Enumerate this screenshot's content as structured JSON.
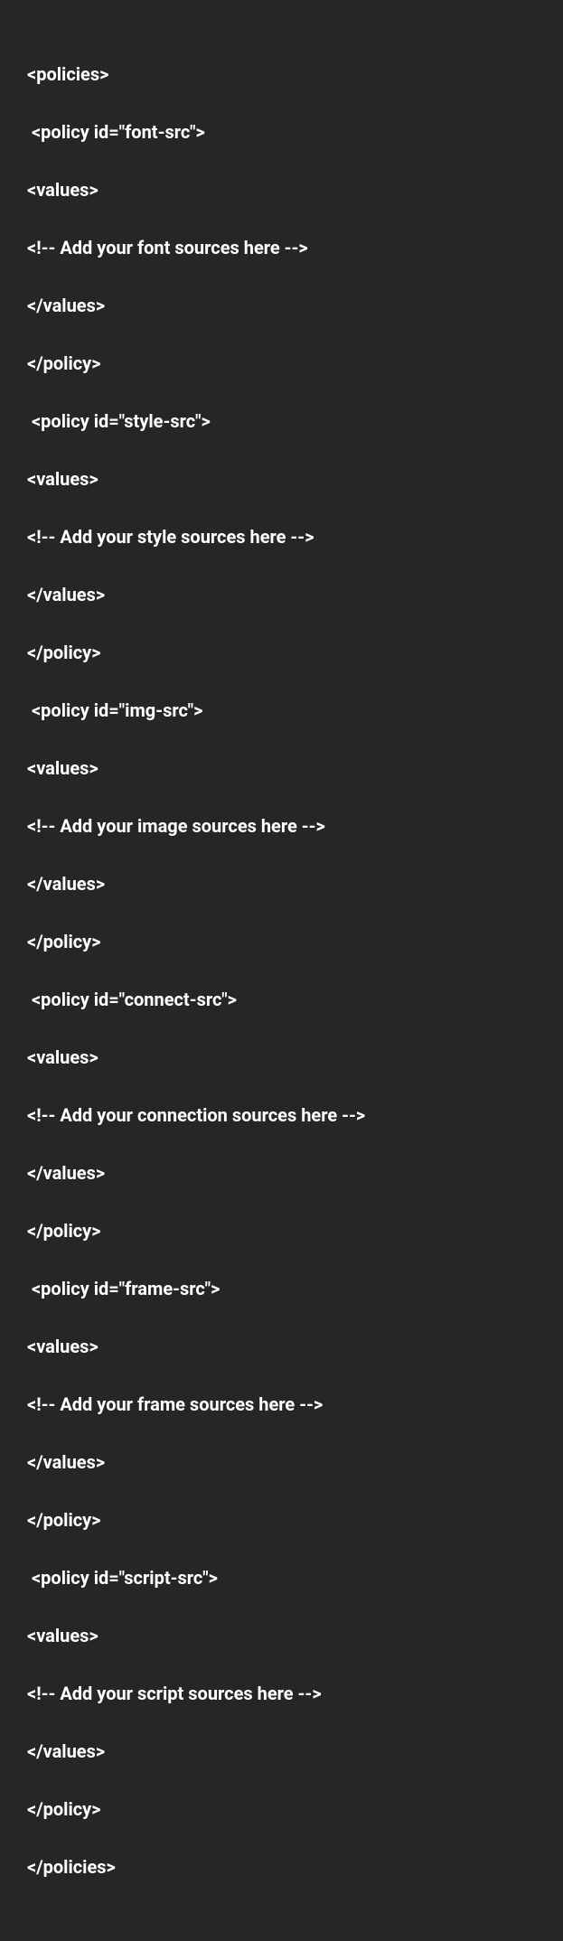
{
  "code": {
    "line1": "<policies>",
    "line2": " <policy id=\"font-src\">",
    "line3": "<values>",
    "line4": "<!-- Add your font sources here -->",
    "line5": "</values>",
    "line6": "</policy>",
    "line7": " <policy id=\"style-src\">",
    "line8": "<values>",
    "line9": "<!-- Add your style sources here -->",
    "line10": "</values>",
    "line11": "</policy>",
    "line12": " <policy id=\"img-src\">",
    "line13": "<values>",
    "line14": "<!-- Add your image sources here -->",
    "line15": "</values>",
    "line16": "</policy>",
    "line17": " <policy id=\"connect-src\">",
    "line18": "<values>",
    "line19": "<!-- Add your connection sources here -->",
    "line20": "</values>",
    "line21": "</policy>",
    "line22": " <policy id=\"frame-src\">",
    "line23": "<values>",
    "line24": "<!-- Add your frame sources here -->",
    "line25": "</values>",
    "line26": "</policy>",
    "line27": " <policy id=\"script-src\">",
    "line28": "<values>",
    "line29": "<!-- Add your script sources here -->",
    "line30": "</values>",
    "line31": "</policy>",
    "line32": "</policies>"
  }
}
